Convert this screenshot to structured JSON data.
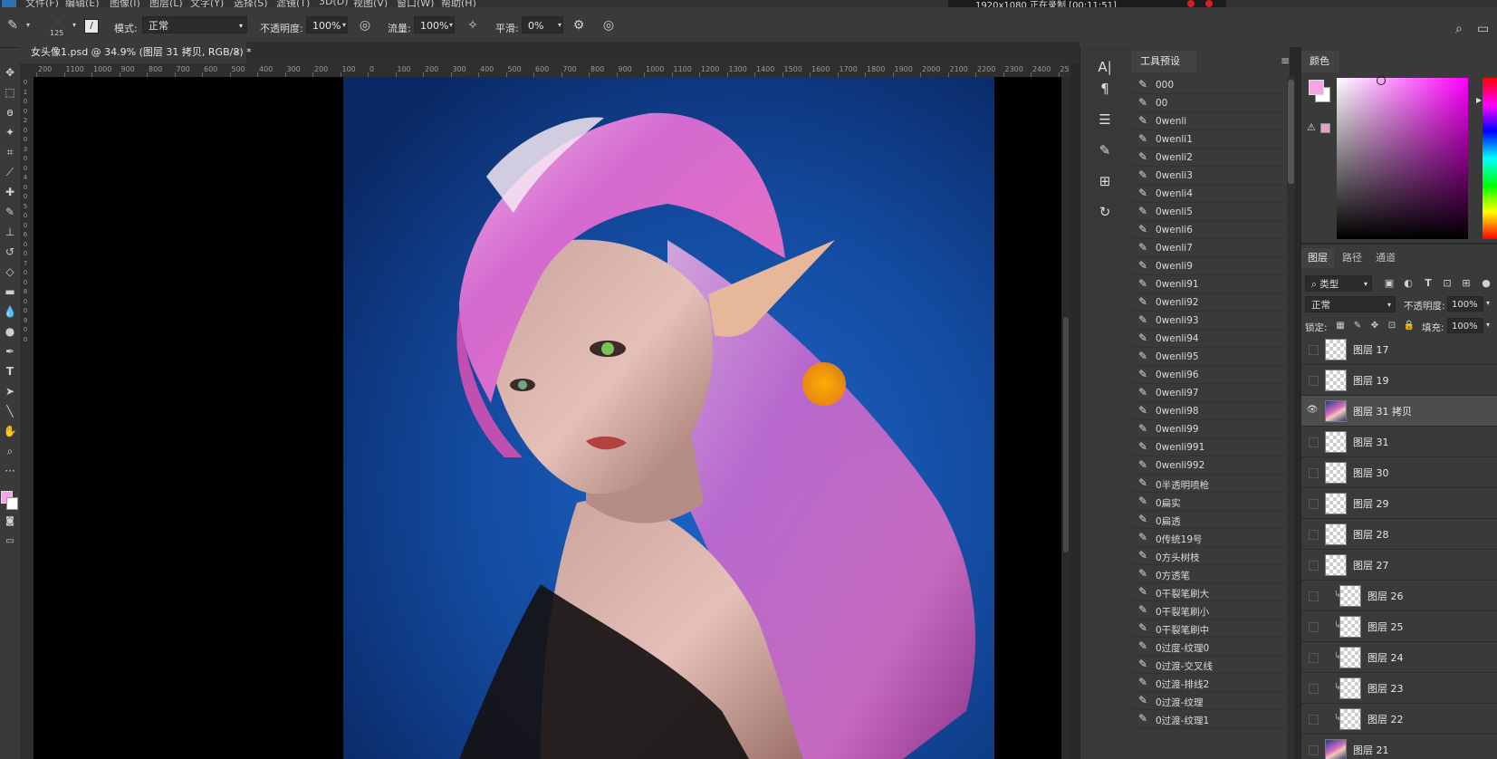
{
  "menu": [
    "文件(F)",
    "编辑(E)",
    "图像(I)",
    "图层(L)",
    "文字(Y)",
    "选择(S)",
    "滤镜(T)",
    "3D(D)",
    "视图(V)",
    "窗口(W)",
    "帮助(H)"
  ],
  "recorder": {
    "text": "1920x1080  正在录制 [00:11:51]"
  },
  "options": {
    "brush_size": "125",
    "mode_label": "模式:",
    "mode_value": "正常",
    "opacity_label": "不透明度:",
    "opacity_value": "100%",
    "flow_label": "流量:",
    "flow_value": "100%",
    "smooth_label": "平滑:",
    "smooth_value": "0%"
  },
  "document": {
    "tab_title": "女头像1.psd @ 34.9% (图层 31 拷贝, RGB/8) *",
    "close": "×"
  },
  "ruler": {
    "h_ticks": [
      "200",
      "1100",
      "1000",
      "900",
      "800",
      "700",
      "600",
      "500",
      "400",
      "300",
      "200",
      "100",
      "0",
      "100",
      "200",
      "300",
      "400",
      "500",
      "600",
      "700",
      "800",
      "900",
      "1000",
      "1100",
      "1200",
      "1300",
      "1400",
      "1500",
      "1600",
      "1700",
      "1800",
      "1900",
      "2000",
      "2100",
      "2200",
      "2300",
      "2400",
      "25"
    ],
    "v_ticks": [
      "0",
      "1",
      "0",
      "0",
      "2",
      "0",
      "0",
      "3",
      "0",
      "0",
      "4",
      "0",
      "0",
      "5",
      "0",
      "0",
      "6",
      "0",
      "0",
      "7",
      "0",
      "0",
      "8",
      "0",
      "0",
      "9",
      "0",
      "0"
    ]
  },
  "tool_presets": {
    "tab": "工具预设",
    "items": [
      "000",
      "00",
      "0wenli",
      "0wenli1",
      "0wenli2",
      "0wenli3",
      "0wenli4",
      "0wenli5",
      "0wenli6",
      "0wenli7",
      "0wenli9",
      "0wenli91",
      "0wenli92",
      "0wenli93",
      "0wenli94",
      "0wenli95",
      "0wenli96",
      "0wenli97",
      "0wenli98",
      "0wenli99",
      "0wenli991",
      "0wenli992",
      "0半透明喷枪",
      "0扁实",
      "0扁透",
      "0传统19号",
      "0方头树枝",
      "0方透笔",
      "0干裂笔刷大",
      "0干裂笔刷小",
      "0干裂笔刷中",
      "0过度-纹理0",
      "0过渡-交叉线",
      "0过渡-排线2",
      "0过渡-纹理",
      "0过渡-纹理1"
    ]
  },
  "color_panel": {
    "tab": "颜色",
    "fg_color": "#f2a6e6",
    "bg_color": "#ffffff",
    "gamut_color": "#e8a0c8",
    "warn_icon": "warning-icon"
  },
  "layers_panel": {
    "tabs": [
      "图层",
      "路径",
      "通道"
    ],
    "filter_label": "类型",
    "blend_mode": "正常",
    "opacity_label": "不透明度:",
    "opacity_value": "100%",
    "lock_label": "锁定:",
    "fill_label": "填充:",
    "fill_value": "100%",
    "layers": [
      {
        "name": "图层 17",
        "visible": false,
        "selected": false,
        "clipped": false,
        "image": false
      },
      {
        "name": "图层 19",
        "visible": false,
        "selected": false,
        "clipped": false,
        "image": false
      },
      {
        "name": "图层 31 拷贝",
        "visible": true,
        "selected": true,
        "clipped": false,
        "image": true
      },
      {
        "name": "图层 31",
        "visible": false,
        "selected": false,
        "clipped": false,
        "image": false
      },
      {
        "name": "图层 30",
        "visible": false,
        "selected": false,
        "clipped": false,
        "image": false
      },
      {
        "name": "图层 29",
        "visible": false,
        "selected": false,
        "clipped": false,
        "image": false
      },
      {
        "name": "图层 28",
        "visible": false,
        "selected": false,
        "clipped": false,
        "image": false
      },
      {
        "name": "图层 27",
        "visible": false,
        "selected": false,
        "clipped": false,
        "image": false
      },
      {
        "name": "图层 26",
        "visible": false,
        "selected": false,
        "clipped": true,
        "image": false
      },
      {
        "name": "图层 25",
        "visible": false,
        "selected": false,
        "clipped": true,
        "image": false
      },
      {
        "name": "图层 24",
        "visible": false,
        "selected": false,
        "clipped": true,
        "image": false
      },
      {
        "name": "图层 23",
        "visible": false,
        "selected": false,
        "clipped": true,
        "image": false
      },
      {
        "name": "图层 22",
        "visible": false,
        "selected": false,
        "clipped": true,
        "image": false
      },
      {
        "name": "图层 21",
        "visible": false,
        "selected": false,
        "clipped": false,
        "image": true
      }
    ]
  },
  "colors": {
    "accent_cursor": "#f5a000",
    "panel_bg": "#3a3a3a",
    "canvas_bg": "#000000"
  }
}
